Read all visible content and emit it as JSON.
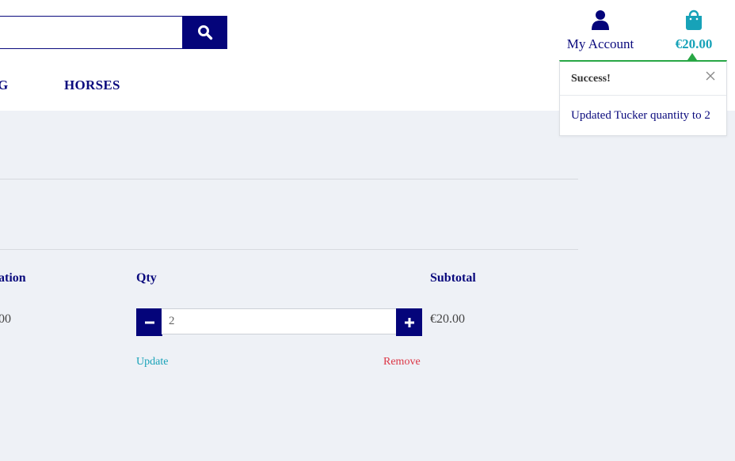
{
  "header": {
    "search": {
      "value": "",
      "placeholder": ""
    },
    "nav": [
      "G",
      "HORSES"
    ],
    "account_label": "My Account",
    "bag_total": "€20.00"
  },
  "toast": {
    "title": "Success!",
    "message": "Updated Tucker quantity to 2"
  },
  "cart": {
    "columns": {
      "price": "ation",
      "qty": "Qty",
      "subtotal": "Subtotal"
    },
    "row": {
      "price": "00",
      "quantity": "2",
      "subtotal": "€20.00",
      "update_label": "Update",
      "remove_label": "Remove"
    }
  },
  "colors": {
    "navy": "#04047a",
    "teal": "#17a2b8",
    "success": "#28a745",
    "remove": "#dc3545",
    "page_bg": "#eef1f6"
  },
  "icons": [
    "search-icon",
    "user-icon",
    "shopping-bag-icon",
    "close-icon",
    "minus-icon",
    "plus-icon"
  ]
}
